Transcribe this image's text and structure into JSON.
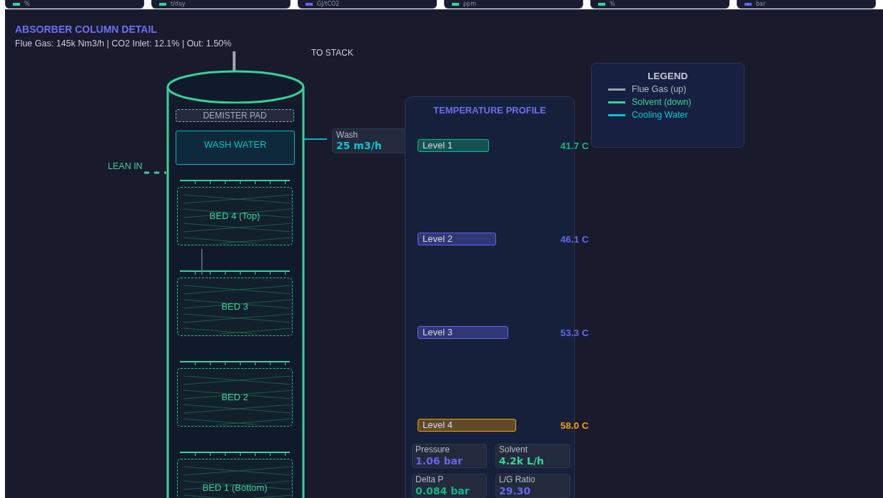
{
  "top_cards": [
    {
      "unit": "%",
      "color": "#34d399"
    },
    {
      "unit": "t/day",
      "color": "#34d399"
    },
    {
      "unit": "GJ/tCO2",
      "color": "#6366f1"
    },
    {
      "unit": "ppm",
      "color": "#34d399"
    },
    {
      "unit": "%",
      "color": "#34d399"
    },
    {
      "unit": "bar",
      "color": "#6366f1"
    }
  ],
  "absorber": {
    "title": "ABSORBER COLUMN DETAIL",
    "subtitle": "Flue Gas: 145k Nm3/h | CO2 Inlet: 12.1% | Out: 1.50%",
    "stack_label": "TO STACK",
    "lean_in_label": "LEAN IN",
    "demister": "DEMISTER PAD",
    "wash_section": "WASH WATER",
    "wash_flow": {
      "label": "Wash",
      "value": "25 m3/h"
    },
    "beds": [
      {
        "label": "BED 4 (Top)"
      },
      {
        "label": "BED 3"
      },
      {
        "label": "BED 2"
      },
      {
        "label": "BED 1 (Bottom)"
      }
    ]
  },
  "temperature_profile": {
    "title": "TEMPERATURE PROFILE",
    "levels": [
      {
        "label": "Level 1",
        "value": "41.7 C",
        "color": "#10b981"
      },
      {
        "label": "Level 2",
        "value": "46.1 C",
        "color": "#6366f1"
      },
      {
        "label": "Level 3",
        "value": "53.3 C",
        "color": "#6366f1"
      },
      {
        "label": "Level 4",
        "value": "58.0 C",
        "color": "#f59e0b"
      }
    ],
    "metrics": [
      {
        "label": "Pressure",
        "value": "1.06 bar",
        "color": "#6366f1"
      },
      {
        "label": "Solvent",
        "value": "4.2k L/h",
        "color": "#34d399"
      },
      {
        "label": "Delta P",
        "value": "0.084 bar",
        "color": "#10b981"
      },
      {
        "label": "L/G Ratio",
        "value": "29.30",
        "color": "#6366f1"
      }
    ]
  },
  "legend": {
    "title": "LEGEND",
    "items": [
      {
        "label": "Flue Gas (up)",
        "color": "#9ca3af"
      },
      {
        "label": "Solvent (down)",
        "color": "#34d399"
      },
      {
        "label": "Cooling Water",
        "color": "#06c8d4"
      }
    ]
  }
}
